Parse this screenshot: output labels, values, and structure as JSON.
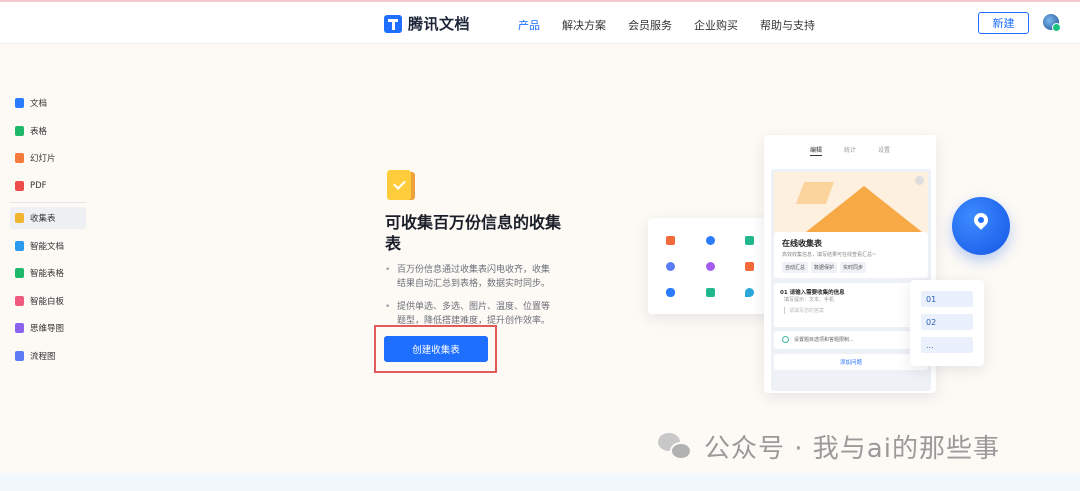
{
  "header": {
    "logo_text": "腾讯文档",
    "nav": [
      "产品",
      "解决方案",
      "会员服务",
      "企业购买",
      "帮助与支持"
    ],
    "new_button": "新建",
    "colors": {
      "accent": "#1e6fff"
    }
  },
  "sidebar": {
    "items": [
      {
        "label": "文档",
        "icon": "doc-icon",
        "color": "#2b7bff"
      },
      {
        "label": "表格",
        "icon": "sheet-icon",
        "color": "#1fb86b"
      },
      {
        "label": "幻灯片",
        "icon": "slides-icon",
        "color": "#f27a3a"
      },
      {
        "label": "PDF",
        "icon": "pdf-icon",
        "color": "#ee4d4d"
      },
      {
        "label": "收集表",
        "icon": "form-icon",
        "color": "#f2b530",
        "active": true
      },
      {
        "label": "智能文档",
        "icon": "smart-doc-icon",
        "color": "#2b9bf0"
      },
      {
        "label": "智能表格",
        "icon": "smart-sheet-icon",
        "color": "#1fb86b"
      },
      {
        "label": "智能白板",
        "icon": "whiteboard-icon",
        "color": "#f05a7e"
      },
      {
        "label": "思维导图",
        "icon": "mindmap-icon",
        "color": "#8a63f0"
      },
      {
        "label": "流程图",
        "icon": "flowchart-icon",
        "color": "#5b7cf5"
      }
    ]
  },
  "main": {
    "feature_icon": "form-icon",
    "headline": "可收集百万份信息的收集表",
    "bullets": [
      "百万份信息通过收集表闪电收齐，收集结果自动汇总到表格，数据实时同步。",
      "提供单选、多选、图片、温度、位置等题型，降低搭建难度，提升创作效率。"
    ],
    "cta": "创建收集表"
  },
  "illustration": {
    "tabs": [
      "编辑",
      "统计",
      "设置"
    ],
    "card_title": "在线收集表",
    "card_desc": "高效收集信息，填写结果可在线查看汇总~",
    "chips": [
      "自动汇总",
      "数据保护",
      "实时同步"
    ],
    "question_title": "01 请输入需要收集的信息",
    "question_sub": "填写提示：文本、手机",
    "question_input": "请填写您的答案",
    "question2": "设置题目选项和答题限制...",
    "add_button": "添加问题",
    "options": [
      "01",
      "02",
      "..."
    ]
  },
  "watermark": {
    "text": "公众号 · 我与ai的那些事",
    "icon": "wechat-icon"
  }
}
